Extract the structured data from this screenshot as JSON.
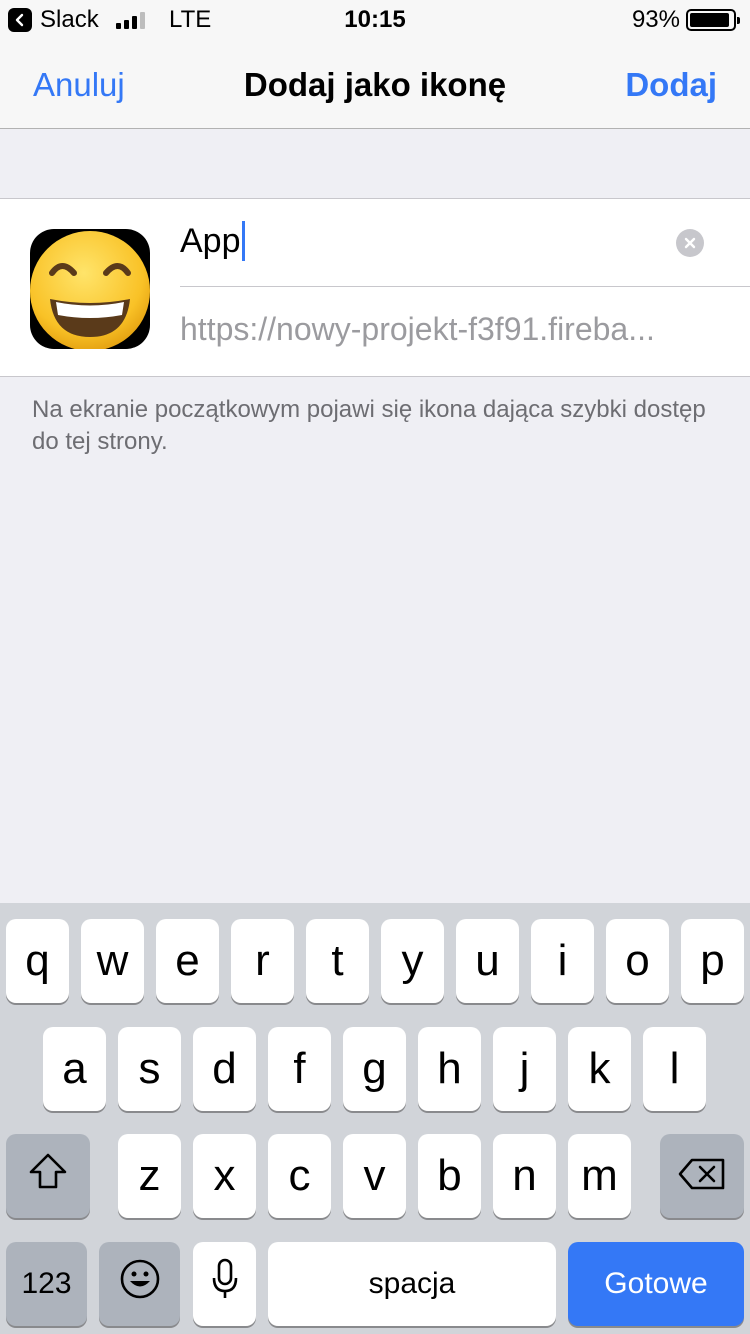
{
  "status_bar": {
    "back_app": "Slack",
    "network": "LTE",
    "time": "10:15",
    "battery": "93%",
    "battery_level": 0.93,
    "signal_bars_active": 3
  },
  "nav": {
    "cancel": "Anuluj",
    "title": "Dodaj jako ikonę",
    "add": "Dodaj"
  },
  "form": {
    "name_value": "App",
    "url": "https://nowy-projekt-f3f91.fireba..."
  },
  "hint": "Na ekranie początkowym pojawi się ikona dająca szybki dostęp do tej strony.",
  "keyboard": {
    "row1": [
      "q",
      "w",
      "e",
      "r",
      "t",
      "y",
      "u",
      "i",
      "o",
      "p"
    ],
    "row2": [
      "a",
      "s",
      "d",
      "f",
      "g",
      "h",
      "j",
      "k",
      "l"
    ],
    "row3": [
      "z",
      "x",
      "c",
      "v",
      "b",
      "n",
      "m"
    ],
    "numbers": "123",
    "space": "spacja",
    "done": "Gotowe",
    "icons": {
      "shift": "shift-icon",
      "delete": "delete-icon",
      "emoji": "emoji-icon",
      "mic": "microphone-icon"
    }
  },
  "colors": {
    "accent": "#3478f6",
    "background": "#efeff4",
    "keyboard": "#d1d4d9"
  }
}
